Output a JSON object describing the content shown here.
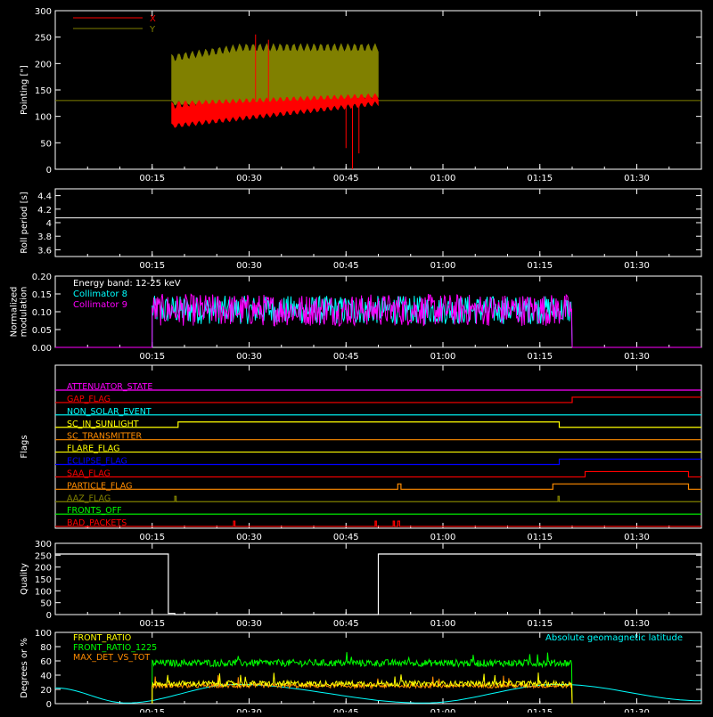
{
  "time_axis": {
    "start_minutes": 0,
    "end_minutes": 100,
    "tick_labels": [
      "00:15",
      "00:30",
      "00:45",
      "01:00",
      "01:15",
      "01:30"
    ],
    "tick_minutes": [
      15,
      30,
      45,
      60,
      75,
      90
    ]
  },
  "chart_data": [
    {
      "type": "line",
      "panel": "pointing",
      "ylabel": "Pointing [\"]",
      "ylim": [
        0,
        300
      ],
      "yticks": [
        0,
        50,
        100,
        150,
        200,
        250,
        300
      ],
      "reference_line": 130,
      "legend_placement": "top-left",
      "series": [
        {
          "name": "X",
          "color": "#ff0000",
          "x_range": [
            18,
            50
          ],
          "band_low": [
            82,
            125
          ],
          "band_high": [
            120,
            140
          ]
        },
        {
          "name": "Y",
          "color": "#808000",
          "x_range": [
            18,
            50
          ],
          "band_low": [
            125,
            140
          ],
          "band_high": [
            210,
            230
          ]
        }
      ]
    },
    {
      "type": "line",
      "panel": "roll_period",
      "ylabel": "Roll period [s]",
      "ylim": [
        3.5,
        4.5
      ],
      "yticks": [
        3.6,
        3.8,
        4.0,
        4.2,
        4.4
      ],
      "series": [
        {
          "color": "#ffffff",
          "x_range": [
            0,
            100
          ],
          "value": 4.07
        }
      ]
    },
    {
      "type": "line",
      "panel": "modulation",
      "ylabel": "Normalized\nmodulation",
      "ylim": [
        0,
        0.2
      ],
      "yticks": [
        0.0,
        0.05,
        0.1,
        0.15,
        0.2
      ],
      "tick_labels": [
        "0.00",
        "0.05",
        "0.10",
        "0.15",
        "0.20"
      ],
      "legend_placement": "top-left",
      "legend_title": "Energy band: 12-25 keV",
      "series": [
        {
          "name": "Collimator 8",
          "color": "#00ffff",
          "x_range": [
            15,
            80
          ],
          "mean": 0.105,
          "spread": 0.04
        },
        {
          "name": "Collimator 9",
          "color": "#ff00ff",
          "x_range": [
            15,
            80
          ],
          "mean": 0.105,
          "spread": 0.045
        }
      ]
    },
    {
      "type": "line",
      "panel": "flags",
      "ylabel": "Flags",
      "flags": [
        {
          "name": "ATTENUATOR_STATE",
          "color": "#ff00ff",
          "changes": []
        },
        {
          "name": "GAP_FLAG",
          "color": "#ff0000",
          "changes": [
            [
              80,
              1
            ]
          ]
        },
        {
          "name": "NON_SOLAR_EVENT",
          "color": "#00ffff",
          "changes": []
        },
        {
          "name": "SC_IN_SUNLIGHT",
          "color": "#ffff00",
          "changes": [
            [
              19,
              1
            ],
            [
              78,
              0
            ]
          ]
        },
        {
          "name": "SC_TRANSMITTER",
          "color": "#ff8c00",
          "changes": []
        },
        {
          "name": "FLARE_FLAG",
          "color": "#ffff00",
          "changes": []
        },
        {
          "name": "ECLIPSE_FLAG",
          "color": "#0000ff",
          "changes": [
            [
              19,
              0
            ],
            [
              78,
              1
            ]
          ]
        },
        {
          "name": "SAA_FLAG",
          "color": "#ff0000",
          "changes": [
            [
              82,
              1
            ],
            [
              98,
              0
            ]
          ]
        },
        {
          "name": "PARTICLE_FLAG",
          "color": "#ff8c00",
          "changes": [
            [
              53,
              1
            ],
            [
              53.5,
              0
            ],
            [
              77,
              1
            ],
            [
              98,
              0
            ]
          ]
        },
        {
          "name": "AAZ_FLAG",
          "color": "#808000",
          "changes": [
            [
              18.5,
              1
            ],
            [
              18.7,
              0
            ],
            [
              77.8,
              1
            ],
            [
              78,
              0
            ]
          ]
        },
        {
          "name": "FRONTS_OFF",
          "color": "#00ff00",
          "changes": []
        },
        {
          "name": "BAD_PACKETS",
          "color": "#ff0000",
          "changes": [
            [
              27.6,
              1
            ],
            [
              27.8,
              0
            ],
            [
              49.5,
              1
            ],
            [
              49.7,
              0
            ],
            [
              52.3,
              1
            ],
            [
              52.5,
              0
            ],
            [
              53,
              1
            ],
            [
              53.3,
              0
            ]
          ]
        }
      ]
    },
    {
      "type": "line",
      "panel": "quality",
      "ylabel": "Quality",
      "ylim": [
        0,
        300
      ],
      "yticks": [
        0,
        50,
        100,
        150,
        200,
        250,
        300
      ],
      "series": [
        {
          "color": "#ffffff",
          "steps": [
            [
              0,
              255
            ],
            [
              17.5,
              5
            ],
            [
              18.5,
              0
            ],
            [
              50,
              255
            ],
            [
              100,
              255
            ]
          ]
        }
      ]
    },
    {
      "type": "line",
      "panel": "ratios",
      "ylabel": "Degrees or %",
      "ylim": [
        0,
        100
      ],
      "yticks": [
        0,
        20,
        40,
        60,
        80,
        100
      ],
      "legend_placement": "top-left",
      "series": [
        {
          "name": "FRONT_RATIO",
          "color": "#ffff00",
          "x_range": [
            15,
            80
          ],
          "mean": 28,
          "spread": 4
        },
        {
          "name": "FRONT_RATIO_1225",
          "color": "#00ff00",
          "x_range": [
            15,
            80
          ],
          "mean": 57,
          "spread": 5
        },
        {
          "name": "MAX_DET_VS_TOT",
          "color": "#ff8c00",
          "x_range": [
            15,
            80
          ],
          "mean": 25,
          "spread": 3
        }
      ],
      "curve": {
        "name": "Absolute geomagnetic latitude",
        "color": "#00ffff",
        "points": [
          [
            0,
            22
          ],
          [
            11,
            1
          ],
          [
            28,
            27
          ],
          [
            57,
            1
          ],
          [
            78,
            27
          ],
          [
            100,
            4
          ]
        ]
      }
    }
  ]
}
